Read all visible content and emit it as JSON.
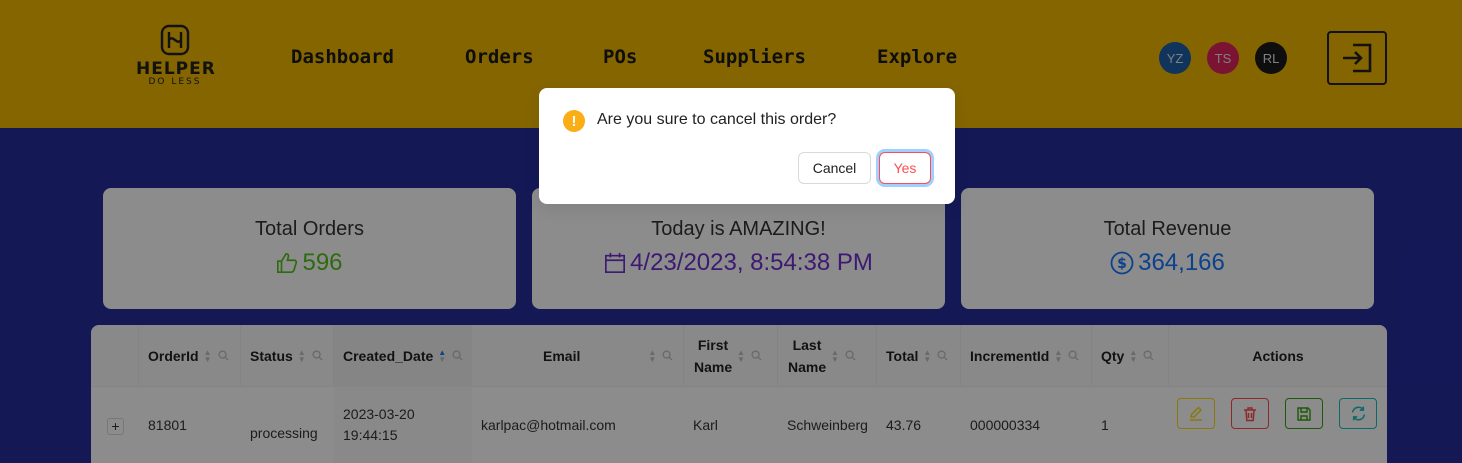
{
  "brand": {
    "line1": "HELPER",
    "line2": "DO LESS"
  },
  "nav": [
    "Dashboard",
    "Orders",
    "POs",
    "Suppliers",
    "Explore"
  ],
  "avatars": [
    {
      "initials": "YZ",
      "color": "#1e5fa8"
    },
    {
      "initials": "TS",
      "color": "#e0245e"
    },
    {
      "initials": "RL",
      "color": "#1a1a1a"
    }
  ],
  "cards": [
    {
      "title": "Total Orders",
      "value": "596",
      "color": "#52c41a",
      "icon": "thumbs-up-icon"
    },
    {
      "title": "Today is AMAZING!",
      "value": "4/23/2023, 8:54:38 PM",
      "color": "#722ed1",
      "icon": "calendar-icon"
    },
    {
      "title": "Total Revenue",
      "value": "364,166",
      "color": "#1677ff",
      "icon": "dollar-icon"
    }
  ],
  "table": {
    "columns": [
      "OrderId",
      "Status",
      "Created_Date",
      "Email",
      "First Name",
      "Last Name",
      "Total",
      "IncrementId",
      "Qty",
      "Actions"
    ],
    "rows": [
      {
        "order_id": "81801",
        "status": "processing",
        "created_date": "2023-03-20 19:44:15",
        "email": "karlpac@hotmail.com",
        "first_name": "Karl",
        "last_name": "Schweinberg",
        "total": "43.76",
        "increment_id": "000000334",
        "qty": "1"
      }
    ],
    "expand_symbol": "+"
  },
  "modal": {
    "title": "Are you sure to cancel this order?",
    "icon": "!",
    "cancel_label": "Cancel",
    "confirm_label": "Yes"
  },
  "colors": {
    "header": "#f0b800",
    "background": "#262c9c",
    "edit": "#fadb14",
    "delete": "#ff4d4f",
    "save": "#389e0d",
    "refresh": "#13c2c2"
  }
}
